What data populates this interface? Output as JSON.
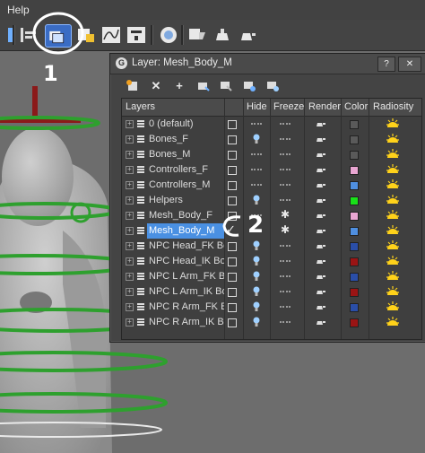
{
  "menubar": {
    "help_label": "Help"
  },
  "dialog": {
    "title": "Layer: Mesh_Body_M",
    "help_btn": "?",
    "close_btn": "✕",
    "headers": {
      "layers": "Layers",
      "hide": "Hide",
      "freeze": "Freeze",
      "render": "Render",
      "color": "Color",
      "radiosity": "Radiosity"
    },
    "rows": [
      {
        "name": "0 (default)",
        "color": "#5a5a5a",
        "selected": false,
        "active": false,
        "hidden": false,
        "frozen": false
      },
      {
        "name": "Bones_F",
        "color": "#5a5a5a",
        "selected": false,
        "active": false,
        "hidden": true,
        "frozen": false
      },
      {
        "name": "Bones_M",
        "color": "#5a5a5a",
        "selected": false,
        "active": false,
        "hidden": false,
        "frozen": false
      },
      {
        "name": "Controllers_F",
        "color": "#e9a6d2",
        "selected": false,
        "active": false,
        "hidden": false,
        "frozen": false
      },
      {
        "name": "Controllers_M",
        "color": "#4f8fe0",
        "selected": false,
        "active": false,
        "hidden": false,
        "frozen": false
      },
      {
        "name": "Helpers",
        "color": "#19e019",
        "selected": false,
        "active": false,
        "hidden": true,
        "frozen": false
      },
      {
        "name": "Mesh_Body_F",
        "color": "#e9a6d2",
        "selected": false,
        "active": false,
        "hidden": false,
        "frozen": true
      },
      {
        "name": "Mesh_Body_M",
        "color": "#4f8fe0",
        "selected": true,
        "active": true,
        "hidden": false,
        "frozen": true
      },
      {
        "name": "NPC Head_FK Bones",
        "color": "#2a4ea8",
        "selected": false,
        "active": false,
        "hidden": true,
        "frozen": false
      },
      {
        "name": "NPC Head_IK Bones",
        "color": "#9a1414",
        "selected": false,
        "active": false,
        "hidden": true,
        "frozen": false
      },
      {
        "name": "NPC L Arm_FK Bone",
        "color": "#2a4ea8",
        "selected": false,
        "active": false,
        "hidden": true,
        "frozen": false
      },
      {
        "name": "NPC L Arm_IK Bone",
        "color": "#9a1414",
        "selected": false,
        "active": false,
        "hidden": true,
        "frozen": false
      },
      {
        "name": "NPC R Arm_FK Bone",
        "color": "#2a4ea8",
        "selected": false,
        "active": false,
        "hidden": true,
        "frozen": false
      },
      {
        "name": "NPC R Arm_IK Bone",
        "color": "#9a1414",
        "selected": false,
        "active": false,
        "hidden": true,
        "frozen": false
      }
    ]
  },
  "annotations": {
    "one": "1",
    "two": "2"
  },
  "colors": {
    "accent_select": "#4a90e2",
    "bulb": "#9fd0ff",
    "sun": "#ffd21a"
  }
}
